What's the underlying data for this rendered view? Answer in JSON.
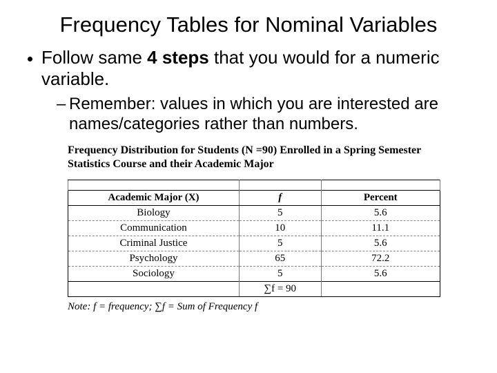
{
  "title": "Frequency Tables for Nominal Variables",
  "bullet1_pre": "Follow same ",
  "bullet1_bold": "4 steps",
  "bullet1_post": " that you would for a numeric variable.",
  "bullet2": "Remember: values in which you are interested are names/categories rather than numbers.",
  "table_title": "Frequency Distribution for Students (N =90) Enrolled in a Spring Semester Statistics Course and their Academic Major",
  "headers": {
    "major": "Academic Major (X)",
    "f": "f",
    "pct": "Percent"
  },
  "rows": [
    {
      "major": "Biology",
      "f": "5",
      "pct": "5.6"
    },
    {
      "major": "Communication",
      "f": "10",
      "pct": "11.1"
    },
    {
      "major": "Criminal Justice",
      "f": "5",
      "pct": "5.6"
    },
    {
      "major": "Psychology",
      "f": "65",
      "pct": "72.2"
    },
    {
      "major": "Sociology",
      "f": "5",
      "pct": "5.6"
    }
  ],
  "total": {
    "major": "",
    "f": "∑f = 90",
    "pct": ""
  },
  "note": "Note: f = frequency; ∑f = Sum of Frequency f",
  "chart_data": {
    "type": "table",
    "title": "Frequency Distribution for Students (N=90) by Academic Major",
    "categories": [
      "Biology",
      "Communication",
      "Criminal Justice",
      "Psychology",
      "Sociology"
    ],
    "series": [
      {
        "name": "f",
        "values": [
          5,
          10,
          5,
          65,
          5
        ]
      },
      {
        "name": "Percent",
        "values": [
          5.6,
          11.1,
          5.6,
          72.2,
          5.6
        ]
      }
    ],
    "n": 90
  }
}
